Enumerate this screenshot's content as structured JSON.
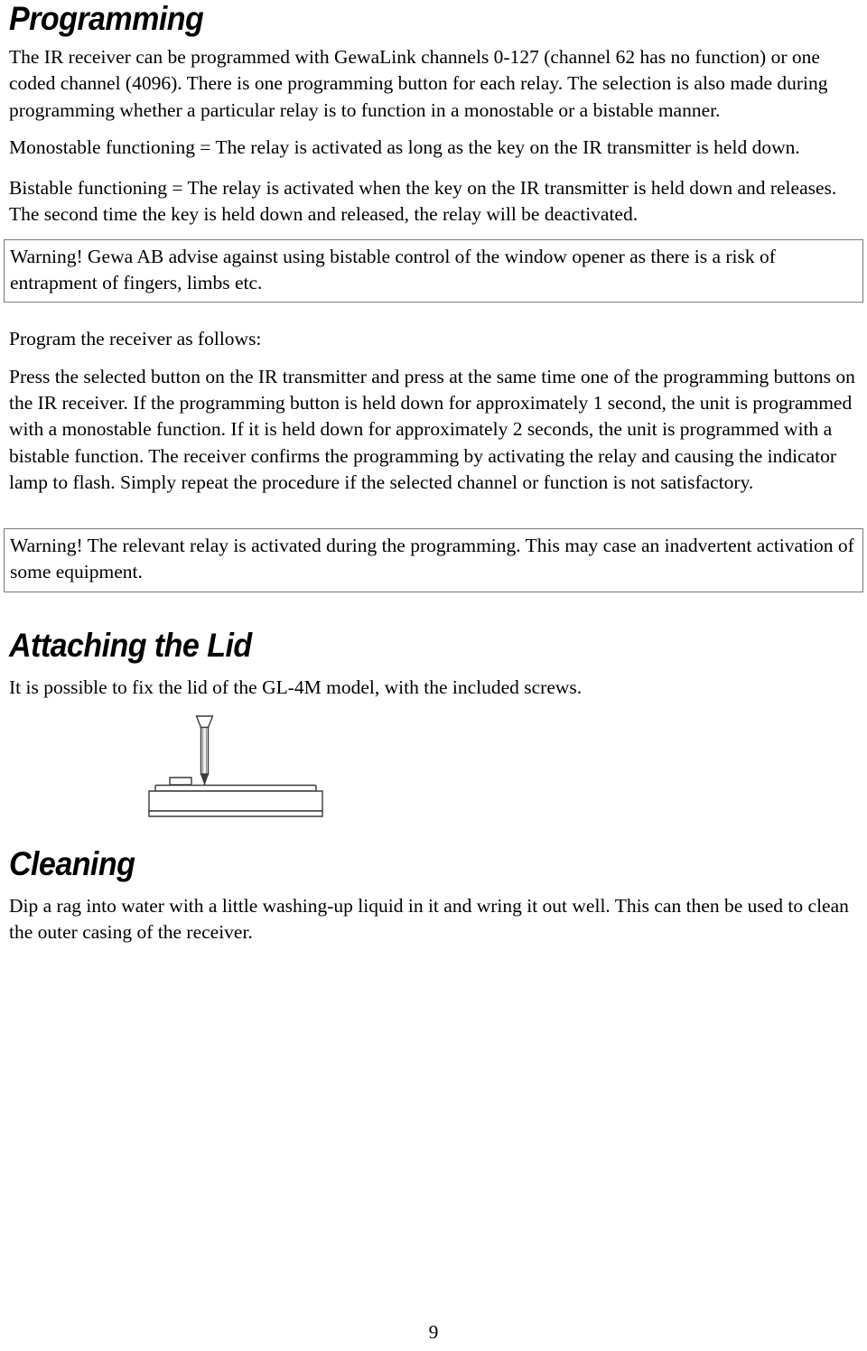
{
  "document": {
    "page_number": "9"
  },
  "sections": {
    "programming": {
      "heading": "Programming",
      "intro_paragraph": "The IR receiver can be programmed with GewaLink channels 0-127 (channel 62 has no function) or one coded channel (4096). There is one programming button for each relay. The selection is also made during programming whether a particular relay is to function in a monostable or a bistable manner.",
      "monostable_paragraph": "Monostable functioning = The relay is activated as long as the key on the IR transmitter is held down.",
      "bistable_paragraph": "Bistable functioning = The relay is activated when the key on the IR transmitter is held down and releases. The second time the key is held down and released, the relay will be deactivated.",
      "warning_bistable": "Warning! Gewa AB advise against using bistable control of the window opener as there is a risk of entrapment of fingers, limbs etc.",
      "program_intro": "Program the receiver as follows:",
      "program_steps": "Press the selected button on the IR transmitter and press at the same time one of the programming buttons on the IR receiver. If the programming button is held down for approximately 1 second, the unit is programmed with a monostable function. If it is held down for approximately 2 seconds, the unit is programmed with a bistable function. The receiver confirms the programming by activating the relay and causing the indicator lamp to flash. Simply repeat the procedure if the selected channel or function is not satisfactory.",
      "warning_relay": "Warning! The relevant relay is activated during the programming. This may case an inadvertent activation of some equipment."
    },
    "attaching_the_lid": {
      "heading": "Attaching the Lid",
      "paragraph": "It is possible to fix the lid of the GL-4M model, with the included screws.",
      "figure": {
        "name": "receiver-lid-screw-diagram",
        "description": "Line drawing of a receiver casing in side view with a countersunk screw positioned above it and a dashed centre line indicating the screw insertion axis."
      }
    },
    "cleaning": {
      "heading": "Cleaning",
      "paragraph": "Dip a rag into water with a little washing-up liquid in it and wring it out well. This can then be used to clean the outer casing of the receiver."
    }
  },
  "colors": {
    "text": "#000000",
    "background": "#ffffff",
    "box_border": "#7a7a7a",
    "diagram_stroke": "#3a3a3a"
  }
}
